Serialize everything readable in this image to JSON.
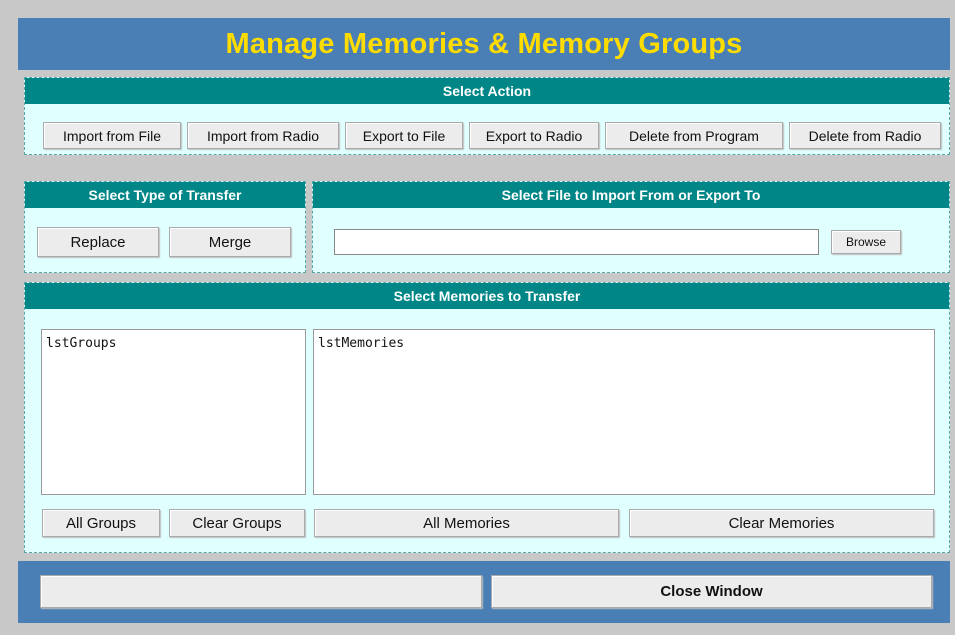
{
  "title": "Manage Memories & Memory Groups",
  "action_panel": {
    "heading": "Select Action",
    "buttons": [
      "Import from File",
      "Import from Radio",
      "Export to File",
      "Export to Radio",
      "Delete from Program",
      "Delete from Radio"
    ]
  },
  "transfer_type_panel": {
    "heading": "Select Type of Transfer",
    "replace_label": "Replace",
    "merge_label": "Merge"
  },
  "file_panel": {
    "heading": "Select File to Import From or Export To",
    "file_value": "",
    "browse_label": "Browse"
  },
  "memories_panel": {
    "heading": "Select Memories to Transfer",
    "groups_list_text": "lstGroups",
    "memories_list_text": "lstMemories",
    "all_groups_label": "All Groups",
    "clear_groups_label": "Clear Groups",
    "all_memories_label": "All Memories",
    "clear_memories_label": "Clear Memories"
  },
  "footer": {
    "status_text": "",
    "close_label": "Close Window"
  },
  "colors": {
    "title_bar": "#4a7fb5",
    "title_text": "#ffdc00",
    "panel_header": "#008686",
    "panel_body": "#e0ffff"
  }
}
